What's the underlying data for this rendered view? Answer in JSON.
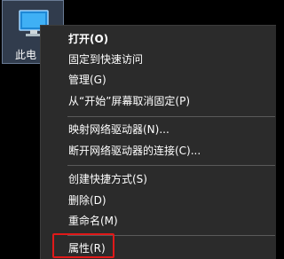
{
  "desktop": {
    "icon": {
      "icon_name": "this-pc-icon",
      "label": "此电"
    }
  },
  "context_menu": {
    "items": [
      {
        "label": "打开(O)",
        "default": true
      },
      {
        "label": "固定到快速访问"
      },
      {
        "label": "管理(G)"
      },
      {
        "label": "从“开始”屏幕取消固定(P)"
      },
      {
        "label": "映射网络驱动器(N)..."
      },
      {
        "label": "断开网络驱动器的连接(C)..."
      },
      {
        "label": "创建快捷方式(S)"
      },
      {
        "label": "删除(D)"
      },
      {
        "label": "重命名(M)"
      },
      {
        "label": "属性(R)"
      }
    ],
    "highlighted_item": "属性(R)",
    "highlight_color": "#e01919"
  }
}
